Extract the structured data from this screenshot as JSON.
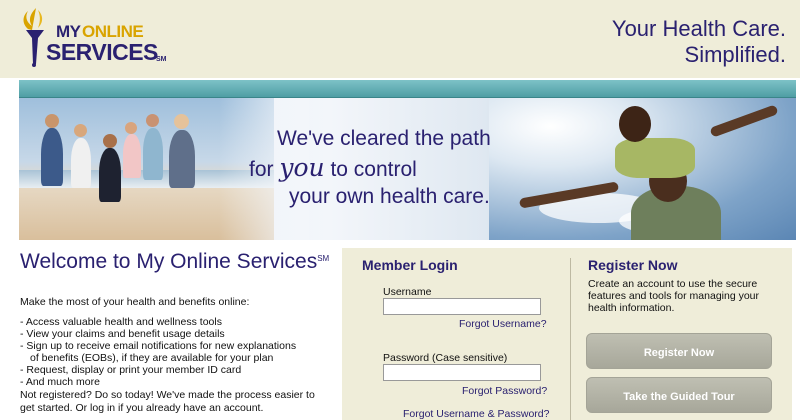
{
  "header": {
    "logo": {
      "my": "MY",
      "online": "ONLINE",
      "services": "SERVICES",
      "sm": "SM"
    },
    "tagline_line1": "Your Health Care.",
    "tagline_line2": "Simplified."
  },
  "banner": {
    "line1": "We've cleared the path",
    "line2_pre": "for ",
    "line2_emph": "you",
    "line2_post": " to control",
    "line3": "your own health care."
  },
  "welcome": {
    "title": "Welcome to My Online Services",
    "title_sup": "SM",
    "intro": "Make the most of your health and benefits online:",
    "bullets": [
      "- Access valuable health and wellness tools",
      "- View your claims and benefit usage details",
      "- Sign up to receive email notifications for new explanations",
      "of benefits (EOBs), if they are available for your plan",
      "- Request, display or print your member ID card",
      "- And much more"
    ],
    "not_registered": "Not registered? Do so today! We've made the process easier to get started. Or log in if you already have an account."
  },
  "login": {
    "title": "Member Login",
    "username_label": "Username",
    "username_value": "",
    "forgot_username": "Forgot Username?",
    "password_label": "Password (Case sensitive)",
    "password_value": "",
    "forgot_password": "Forgot Password?",
    "forgot_both": "Forgot Username & Password?"
  },
  "register": {
    "title": "Register Now",
    "text": "Create an account to use the secure features and tools for managing your health information.",
    "register_button": "Register Now",
    "tour_button": "Take the Guided Tour"
  }
}
